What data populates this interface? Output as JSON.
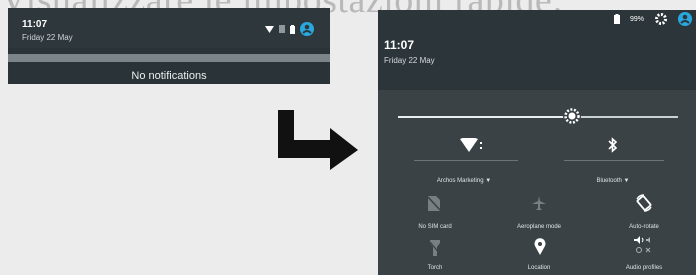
{
  "heading": {
    "text": "Visualizzare le impostazioni rapide:"
  },
  "left_panel": {
    "time": "11:07",
    "date": "Friday 22 May",
    "empty_text": "No notifications"
  },
  "right_panel": {
    "time": "11:07",
    "date": "Friday 22 May",
    "battery": "99%",
    "brightness_level": 0.62,
    "tiles": {
      "wifi_label": "Archos Marketing",
      "bluetooth_label": "Bluetooth",
      "sim_label": "No SIM card",
      "airplane_label": "Aeroplane mode",
      "autorotate_label": "Auto-rotate",
      "torch_label": "Torch",
      "location_label": "Location",
      "audio_label": "Audio profiles"
    }
  },
  "colors": {
    "accent": "#29a8e0",
    "panel": "#3a4246",
    "header": "#2c3539"
  }
}
